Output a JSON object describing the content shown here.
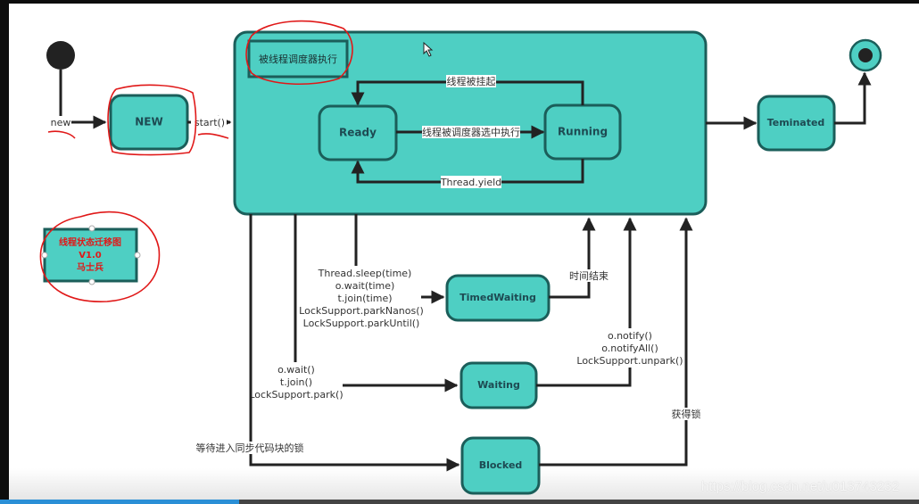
{
  "diagram": {
    "title_box": {
      "lines": [
        "线程状态迁移图",
        "V1.0",
        "马士兵"
      ],
      "text_color": "#e01818"
    },
    "composite_state": {
      "label": "被线程调度器执行"
    },
    "states": {
      "new": "NEW",
      "ready": "Ready",
      "running": "Running",
      "terminated": "Teminated",
      "timed_waiting": "TimedWaiting",
      "waiting": "Waiting",
      "blocked": "Blocked"
    },
    "transitions": {
      "initial_to_new": "new",
      "new_to_runnable": "start()",
      "running_to_ready_suspend": "线程被挂起",
      "ready_to_running": "线程被调度器选中执行",
      "running_to_ready_yield": "Thread.yield",
      "to_timed_waiting": [
        "Thread.sleep(time)",
        "o.wait(time)",
        "t.join(time)",
        "LockSupport.parkNanos()",
        "LockSupport.parkUntil()"
      ],
      "timed_waiting_return": "时间结束",
      "to_waiting": [
        "o.wait()",
        "t.join()",
        "LockSupport.park()"
      ],
      "waiting_return": [
        "o.notify()",
        "o.notifyAll()",
        "LockSupport.unpark()"
      ],
      "to_blocked": "等待进入同步代码块的锁",
      "blocked_return": "获得锁"
    },
    "colors": {
      "state_fill": "#4ecfc3",
      "state_border": "#1b5e5a",
      "annotation": "#e01818",
      "edge": "#222222"
    }
  },
  "watermark": "https://blog.csdn.net/u013743232",
  "player": {
    "progress": 0.26
  }
}
